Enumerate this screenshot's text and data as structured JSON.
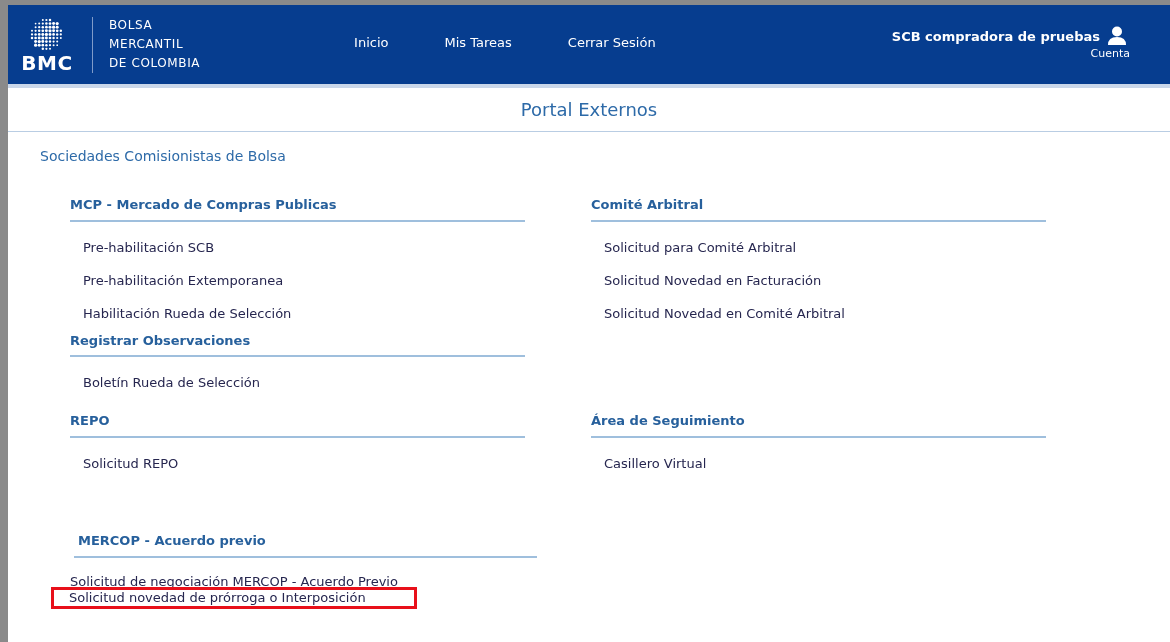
{
  "header": {
    "logo_mark": "BMC",
    "logo_name": [
      "BOLSA",
      "MERCANTIL",
      "DE COLOMBIA"
    ],
    "nav": [
      "Inicio",
      "Mis Tareas",
      "Cerrar Sesión"
    ],
    "user": "SCB compradora de pruebas",
    "account": "Cuenta"
  },
  "page_title": "Portal Externos",
  "subtitle": "Sociedades Comisionistas de Bolsa",
  "rows": [
    {
      "left": [
        {
          "kind": "standard",
          "title": "MCP - Mercado de Compras Publicas",
          "items": [
            {
              "label": "Pre-habilitación SCB",
              "highlighted": false
            },
            {
              "label": "Pre-habilitación Extemporanea",
              "highlighted": false
            },
            {
              "label": "Habilitación Rueda de Selección",
              "highlighted": false
            }
          ]
        },
        {
          "kind": "standard",
          "title": "Registrar Observaciones",
          "items": [
            {
              "label": "Boletín Rueda de Selección",
              "highlighted": false
            }
          ]
        }
      ],
      "right": [
        {
          "kind": "standard",
          "title": "Comité Arbitral",
          "items": [
            {
              "label": "Solicitud para Comité Arbitral",
              "highlighted": false
            },
            {
              "label": "Solicitud Novedad en Facturación",
              "highlighted": false
            },
            {
              "label": "Solicitud Novedad en Comité Arbitral",
              "highlighted": false
            }
          ]
        }
      ]
    },
    {
      "left": [
        {
          "kind": "standard",
          "title": "REPO",
          "items": [
            {
              "label": "Solicitud REPO",
              "highlighted": false
            }
          ]
        }
      ],
      "right": [
        {
          "kind": "standard",
          "title": "Área de Seguimiento",
          "items": [
            {
              "label": "Casillero Virtual",
              "highlighted": false
            }
          ]
        }
      ]
    },
    {
      "left": [
        {
          "kind": "compact",
          "title": "MERCOP - Acuerdo previo",
          "items": [
            {
              "label": "Solicitud de negociación MERCOP - Acuerdo Previo",
              "highlighted": false
            },
            {
              "label": "Solicitud novedad de prórroga o Interposición",
              "highlighted": true
            }
          ]
        }
      ],
      "right": []
    }
  ]
}
